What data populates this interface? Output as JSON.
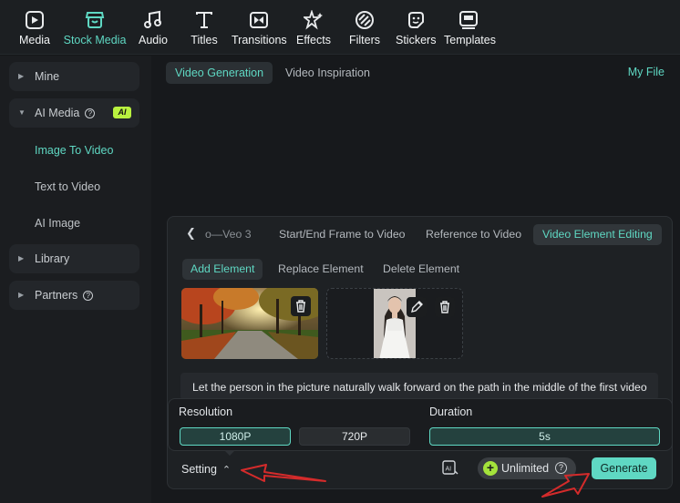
{
  "toolbar": {
    "items": [
      {
        "label": "Media",
        "icon": "media-icon"
      },
      {
        "label": "Stock Media",
        "icon": "stock-media-icon",
        "active": true
      },
      {
        "label": "Audio",
        "icon": "audio-icon"
      },
      {
        "label": "Titles",
        "icon": "titles-icon"
      },
      {
        "label": "Transitions",
        "icon": "transitions-icon"
      },
      {
        "label": "Effects",
        "icon": "effects-icon"
      },
      {
        "label": "Filters",
        "icon": "filters-icon"
      },
      {
        "label": "Stickers",
        "icon": "stickers-icon"
      },
      {
        "label": "Templates",
        "icon": "templates-icon"
      }
    ]
  },
  "sidebar": {
    "mine": "Mine",
    "ai_media": "AI Media",
    "ai_badge": "AI",
    "sub_items": [
      "Image To Video",
      "Text to Video",
      "AI Image"
    ],
    "library": "Library",
    "partners": "Partners"
  },
  "main": {
    "tabs": [
      "Video Generation",
      "Video Inspiration"
    ],
    "my_file": "My File"
  },
  "panel": {
    "model_tabs": [
      "o—Veo 3",
      "Start/End Frame to Video",
      "Reference to Video",
      "Video Element Editing"
    ],
    "edit_tabs": [
      "Add Element",
      "Replace Element",
      "Delete Element"
    ],
    "prompt": "Let the person in the picture naturally walk forward on the path in the middle of the first video",
    "resolution_label": "Resolution",
    "resolution_options": [
      "1080P",
      "720P"
    ],
    "duration_label": "Duration",
    "duration_value": "5s",
    "setting_label": "Setting",
    "credit_label": "Unlimited",
    "generate_label": "Generate"
  },
  "colors": {
    "accent": "#5fd8c3",
    "annotation": "#d42b2b"
  }
}
